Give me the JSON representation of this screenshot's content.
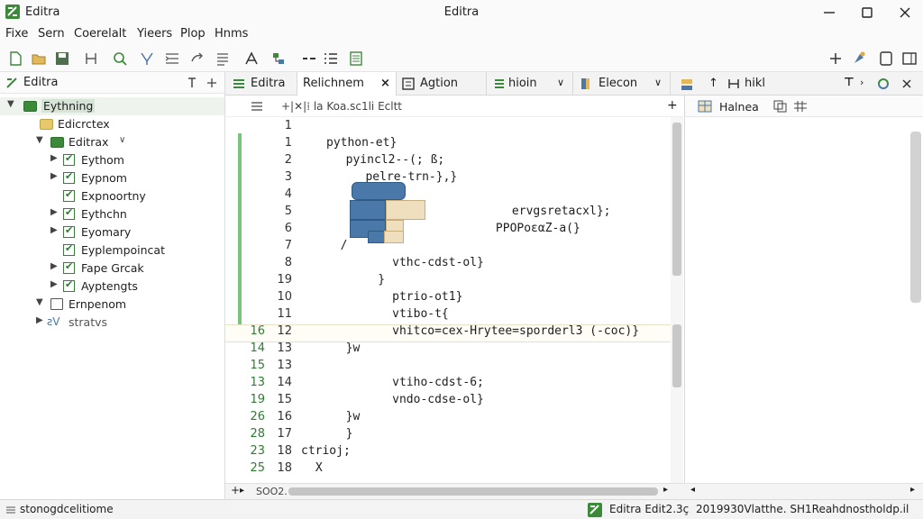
{
  "window": {
    "app_title": "Editra",
    "title": "Editra"
  },
  "menu": [
    "Fixe",
    "Sern",
    "Coerelalt",
    "Yieers",
    "Plop",
    "Hnms"
  ],
  "left_panel": {
    "title": "Editra",
    "tree": [
      {
        "label": "Eythning",
        "type": "root"
      },
      {
        "label": "Edicrctex",
        "type": "folder"
      },
      {
        "label": "Editrax",
        "type": "folder"
      },
      {
        "label": "Eythom",
        "type": "item"
      },
      {
        "label": "Eypnom",
        "type": "item"
      },
      {
        "label": "Expnoortny",
        "type": "item"
      },
      {
        "label": "Eythchn",
        "type": "item"
      },
      {
        "label": "Eyomary",
        "type": "item"
      },
      {
        "label": "Eyplempoincat",
        "type": "item"
      },
      {
        "label": "Fape Grcak",
        "type": "item"
      },
      {
        "label": "Ayptengts",
        "type": "item"
      },
      {
        "label": "Ernpenom",
        "type": "folder"
      },
      {
        "label": "stratvs",
        "type": "misc"
      }
    ]
  },
  "tabs": [
    {
      "label": "Editra"
    },
    {
      "label": "Relichnem",
      "close": "×"
    },
    {
      "label": "Agtion"
    },
    {
      "label": "hioin"
    },
    {
      "label": "Elecon"
    }
  ],
  "right_tabs": {
    "label": "hikl"
  },
  "editor": {
    "breadcrumb": "+|✕|⁞ la Koa.sc1li Ecltt",
    "lines": [
      {
        "a": "",
        "b": "1",
        "text": ""
      },
      {
        "a": "",
        "b": "1",
        "text": "python-et}"
      },
      {
        "a": "",
        "b": "2",
        "text": "  pyincl2--(; ß;"
      },
      {
        "a": "",
        "b": "3",
        "text": "   pelre-trn-},}"
      },
      {
        "a": "",
        "b": "4",
        "text": "     ℓ"
      },
      {
        "a": "",
        "b": "5",
        "text": "            ervgsretacxl};"
      },
      {
        "a": "",
        "b": "6",
        "text": "            ΡΡΟΡοεαZ-a(}"
      },
      {
        "a": "",
        "b": "7",
        "text": "  /"
      },
      {
        "a": "",
        "b": "8",
        "text": "     vthc-cdst-ol}"
      },
      {
        "a": "",
        "b": "19",
        "text": "    }"
      },
      {
        "a": "",
        "b": "10",
        "text": "     ptrio-ot1}"
      },
      {
        "a": "",
        "b": "11",
        "text": "     vtibo-t{"
      },
      {
        "a": "16",
        "b": "12",
        "text": "     vhitco=cex-Hrytee=sporderl3 (-coc)}"
      },
      {
        "a": "14",
        "b": "13",
        "text": "  }w"
      },
      {
        "a": "15",
        "b": "13",
        "text": ""
      },
      {
        "a": "13",
        "b": "14",
        "text": "     vtiho-cdst-6;"
      },
      {
        "a": "19",
        "b": "15",
        "text": "     vndo-cdse-ol}"
      },
      {
        "a": "26",
        "b": "16",
        "text": "  }w"
      },
      {
        "a": "28",
        "b": "17",
        "text": "  }"
      },
      {
        "a": "23",
        "b": "18",
        "text": "ctrioj;"
      },
      {
        "a": "25",
        "b": "18",
        "text": " X"
      }
    ]
  },
  "right_panel": {
    "label": "Halnea"
  },
  "hscroll": {
    "label": "SOO2."
  },
  "status": {
    "left": "stonogdcelitiome",
    "middle": "Editra Edit2.3ç",
    "right": "2019930Vlatthe. SH1Reahdnostholdp.il"
  },
  "colors": {
    "accent": "#3a8a3a",
    "block_blue": "#4a78a8",
    "block_tan": "#f0dfbe"
  }
}
